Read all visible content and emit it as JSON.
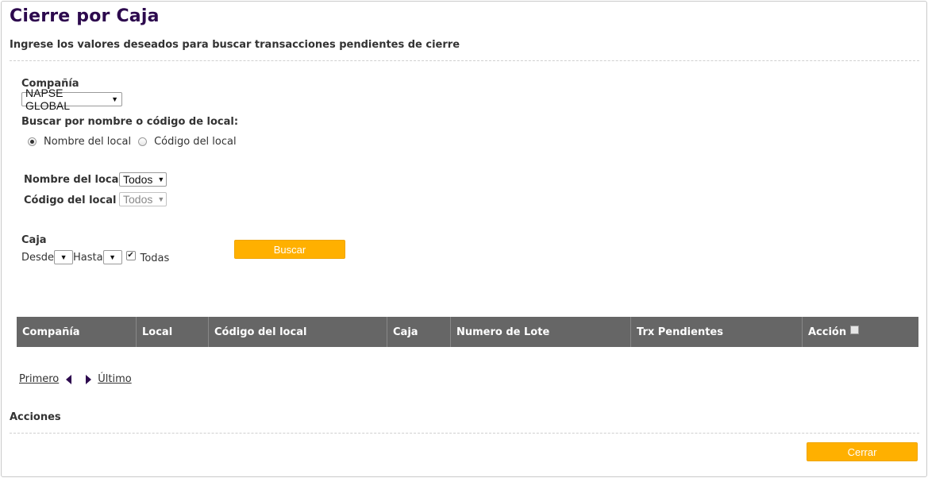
{
  "page": {
    "title": "Cierre por Caja",
    "subtitle": "Ingrese los valores deseados para buscar transacciones pendientes de cierre"
  },
  "filters": {
    "company_label": "Compañía",
    "company_value": "NAPSE GLOBAL",
    "search_by_label": "Buscar por nombre o código de local:",
    "radio_name_label": "Nombre del local",
    "radio_code_label": "Código del local",
    "store_name_label": "Nombre del local",
    "store_name_value": "Todos",
    "store_code_label": "Código del local",
    "store_code_value": "Todos",
    "register_label": "Caja",
    "from_label": "Desde",
    "to_label": "Hasta",
    "all_label": "Todas",
    "search_button": "Buscar"
  },
  "table": {
    "columns": [
      "Compañía",
      "Local",
      "Código del local",
      "Caja",
      "Numero de Lote",
      "Trx Pendientes",
      "Acción"
    ]
  },
  "pagination": {
    "first": "Primero",
    "last": "Último"
  },
  "actions": {
    "title": "Acciones",
    "close_button": "Cerrar"
  },
  "colors": {
    "accent": "#ffb000",
    "title": "#2d0a4e",
    "table_header": "#666666"
  }
}
